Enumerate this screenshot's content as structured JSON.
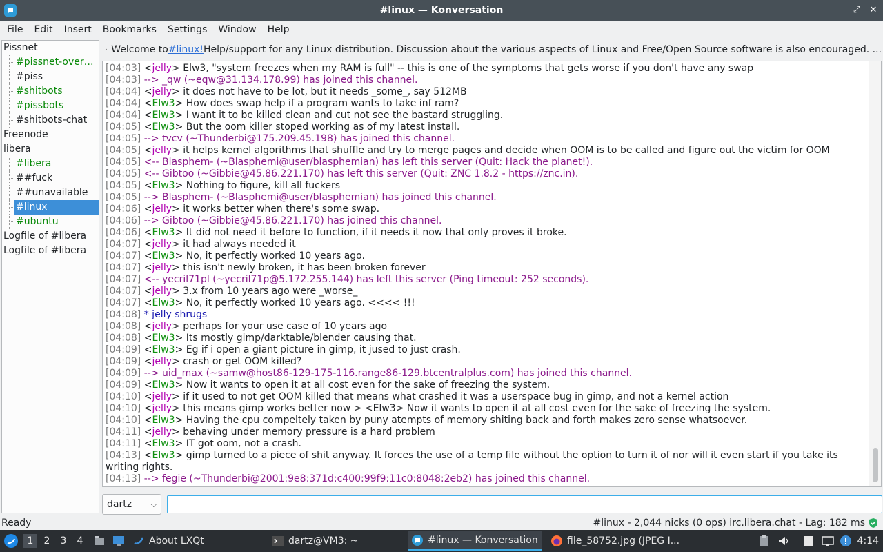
{
  "window": {
    "title": "#linux — Konversation"
  },
  "menu": [
    "File",
    "Edit",
    "Insert",
    "Bookmarks",
    "Settings",
    "Window",
    "Help"
  ],
  "sidebar": [
    {
      "label": "Pissnet",
      "level": 0,
      "color": "normal"
    },
    {
      "label": "#pissnet-overv…",
      "level": 1,
      "color": "green"
    },
    {
      "label": "#piss",
      "level": 1,
      "color": "normal"
    },
    {
      "label": "#shitbots",
      "level": 1,
      "color": "green"
    },
    {
      "label": "#pissbots",
      "level": 1,
      "color": "green"
    },
    {
      "label": "#shitbots-chat",
      "level": 1,
      "color": "normal"
    },
    {
      "label": "Freenode",
      "level": 0,
      "color": "normal"
    },
    {
      "label": "libera",
      "level": 0,
      "color": "normal"
    },
    {
      "label": "#libera",
      "level": 1,
      "color": "green"
    },
    {
      "label": "##fuck",
      "level": 1,
      "color": "normal"
    },
    {
      "label": "##unavailable",
      "level": 1,
      "color": "normal"
    },
    {
      "label": "#linux",
      "level": 1,
      "color": "selected"
    },
    {
      "label": "#ubuntu",
      "level": 1,
      "color": "green"
    },
    {
      "label": "Logfile of #libera",
      "level": 0,
      "color": "normal"
    },
    {
      "label": "Logfile of #libera",
      "level": 0,
      "color": "normal"
    }
  ],
  "topic": {
    "prefix": "Welcome to ",
    "link": "#linux!",
    "rest": " Help/support for any Linux distribution. Discussion about the various aspects of Linux and Free/Open Source software is also encouraged. ..."
  },
  "messages": [
    {
      "ts": "[04:03]",
      "kind": "msg",
      "nick": "jelly",
      "text": " Elw3, \"system freezes when my RAM is full\" -- this is one of the symptoms that gets worse if you don't have any swap"
    },
    {
      "ts": "[04:03]",
      "kind": "join",
      "text": "--> _qw (~eqw@31.134.178.99) has joined this channel."
    },
    {
      "ts": "[04:04]",
      "kind": "msg",
      "nick": "jelly",
      "text": " it does not have to be lot, but it needs _some_, say 512MB"
    },
    {
      "ts": "[04:04]",
      "kind": "msg",
      "nick": "Elw3",
      "text": " How does swap help if a program wants to take inf ram?"
    },
    {
      "ts": "[04:04]",
      "kind": "msg",
      "nick": "Elw3",
      "text": " I want it to be killed clean and cut not see the bastard struggling."
    },
    {
      "ts": "[04:05]",
      "kind": "msg",
      "nick": "Elw3",
      "text": " But the oom killer stoped working as of my latest install."
    },
    {
      "ts": "[04:05]",
      "kind": "join",
      "text": "--> tvcv (~Thunderbi@175.209.45.198) has joined this channel."
    },
    {
      "ts": "[04:05]",
      "kind": "msg",
      "nick": "jelly",
      "text": " it helps kernel algorithms that shuffle and try to merge pages and decide when OOM is to be called and figure out the victim for OOM"
    },
    {
      "ts": "[04:05]",
      "kind": "join",
      "text": "<-- Blasphem- (~Blasphemi@user/blasphemian) has left this server (Quit: Hack the planet!)."
    },
    {
      "ts": "[04:05]",
      "kind": "join",
      "text": "<-- Gibtoo (~Gibbie@45.86.221.170) has left this server (Quit: ZNC 1.8.2 - https://znc.in)."
    },
    {
      "ts": "[04:05]",
      "kind": "msg",
      "nick": "Elw3",
      "text": " Nothing to figure, kill all fuckers"
    },
    {
      "ts": "[04:05]",
      "kind": "join",
      "text": "--> Blasphem- (~Blasphemi@user/blasphemian) has joined this channel."
    },
    {
      "ts": "[04:06]",
      "kind": "msg",
      "nick": "jelly",
      "text": " it works better when there's some swap."
    },
    {
      "ts": "[04:06]",
      "kind": "join",
      "text": "--> Gibtoo (~Gibbie@45.86.221.170) has joined this channel."
    },
    {
      "ts": "[04:06]",
      "kind": "msg",
      "nick": "Elw3",
      "text": " It did not need it before to function, if it needs it now that only proves it broke."
    },
    {
      "ts": "[04:07]",
      "kind": "msg",
      "nick": "jelly",
      "text": " it had always needed it"
    },
    {
      "ts": "[04:07]",
      "kind": "msg",
      "nick": "Elw3",
      "text": " No, it perfectly worked 10 years ago."
    },
    {
      "ts": "[04:07]",
      "kind": "msg",
      "nick": "jelly",
      "text": " this isn't newly broken, it has been broken forever"
    },
    {
      "ts": "[04:07]",
      "kind": "join",
      "text": "<-- yecril71pl (~yecril71p@5.172.255.144) has left this server (Ping timeout: 252 seconds)."
    },
    {
      "ts": "[04:07]",
      "kind": "msg",
      "nick": "jelly",
      "text": " 3.x from 10 years ago were _worse_"
    },
    {
      "ts": "[04:07]",
      "kind": "msg",
      "nick": "Elw3",
      "text": " No, it perfectly worked 10 years ago. <<<< !!!"
    },
    {
      "ts": "[04:08]",
      "kind": "action",
      "text": "* jelly shrugs"
    },
    {
      "ts": "[04:08]",
      "kind": "msg",
      "nick": "jelly",
      "text": " perhaps for your use case of 10 years ago"
    },
    {
      "ts": "[04:08]",
      "kind": "msg",
      "nick": "Elw3",
      "text": " Its mostly gimp/darktable/blender causing that."
    },
    {
      "ts": "[04:09]",
      "kind": "msg",
      "nick": "Elw3",
      "text": " Eg if i open a giant picture in gimp, it jused to just crash."
    },
    {
      "ts": "[04:09]",
      "kind": "msg",
      "nick": "jelly",
      "text": " crash or get OOM killed?"
    },
    {
      "ts": "[04:09]",
      "kind": "join",
      "text": "--> uid_max (~samw@host86-129-175-116.range86-129.btcentralplus.com) has joined this channel."
    },
    {
      "ts": "[04:09]",
      "kind": "msg",
      "nick": "Elw3",
      "text": " Now it wants to open it at all cost even for the sake of freezing the system."
    },
    {
      "ts": "[04:10]",
      "kind": "msg",
      "nick": "jelly",
      "text": " if it used to not get OOM killed that means what crashed it was a userspace bug in gimp, and not a kernel action"
    },
    {
      "ts": "[04:10]",
      "kind": "msg",
      "nick": "jelly",
      "text": " this means gimp works better now > <Elw3> Now it wants to open it at all cost even for the sake of freezing the system."
    },
    {
      "ts": "[04:10]",
      "kind": "msg",
      "nick": "Elw3",
      "text": " Having the cpu compeltely taken by puny atempts of memory shiting back and forth makes zero sense whatsoever."
    },
    {
      "ts": "[04:11]",
      "kind": "msg",
      "nick": "jelly",
      "text": " behaving under memory pressure is a hard problem"
    },
    {
      "ts": "[04:11]",
      "kind": "msg",
      "nick": "Elw3",
      "text": " IT got oom, not a crash."
    },
    {
      "ts": "[04:13]",
      "kind": "msg",
      "nick": "Elw3",
      "text": " gimp turned to a piece of shit anyway. It forces the use of a temp file without the option to turn it of nor will it even start if you take its writing rights."
    },
    {
      "ts": "[04:13]",
      "kind": "join",
      "text": "--> fegie (~Thunderbi@2001:9e8:371d:c400:99f9:11c0:8048:2eb2) has joined this channel."
    }
  ],
  "input": {
    "nick": "dartz",
    "value": ""
  },
  "status": {
    "left": "Ready",
    "right": "#linux - 2,044 nicks (0 ops)  irc.libera.chat - Lag: 182 ms"
  },
  "taskbar": {
    "desktops": [
      "1",
      "2",
      "3",
      "4"
    ],
    "tasks": [
      "About LXQt",
      "dartz@VM3: ~",
      "#linux — Konversation",
      "file_58752.jpg (JPEG I..."
    ],
    "clock": "4:14"
  },
  "colors": {
    "title_bg": "#475057",
    "selection": "#3d8fd8",
    "nick_jelly": "#b000b0",
    "nick_elw3": "#109010",
    "join": "#8b1a8b"
  }
}
